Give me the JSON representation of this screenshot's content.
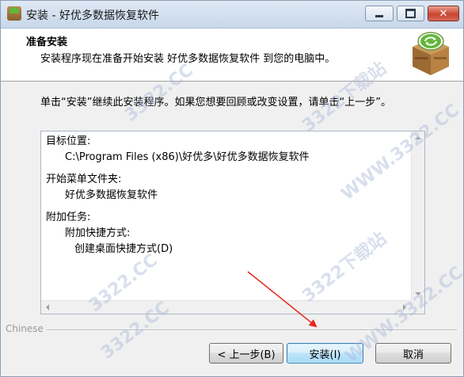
{
  "window": {
    "title": "安装 - 好优多数据恢复软件"
  },
  "header": {
    "title": "准备安装",
    "subtitle": "安装程序现在准备开始安装 好优多数据恢复软件 到您的电脑中。"
  },
  "instruction": "单击“安装”继续此安装程序。如果您想要回顾或改变设置，请单击“上一步”。",
  "memo": {
    "dest_label": "目标位置:",
    "dest_value": "C:\\Program Files (x86)\\好优多\\好优多数据恢复软件",
    "startmenu_label": "开始菜单文件夹:",
    "startmenu_value": "好优多数据恢复软件",
    "tasks_label": "附加任务:",
    "shortcut_group": "附加快捷方式:",
    "shortcut_item": "创建桌面快捷方式(D)"
  },
  "footer": {
    "brand": "Chinese"
  },
  "buttons": {
    "back": "< 上一步(B)",
    "install": "安装(I)",
    "cancel": "取消"
  },
  "watermarks": [
    "3322.CC",
    "3322下载站",
    "WWW.3322.CC",
    "3322.CC",
    "3322下载站",
    "WWW.3322.CC",
    "3322.CC"
  ],
  "colors": {
    "accent": "#3c7fb1",
    "close_button": "#c9452f",
    "arrow": "#e8271c"
  },
  "icons": {
    "app": "package-box-icon",
    "logo": "package-box-recycle-icon"
  }
}
